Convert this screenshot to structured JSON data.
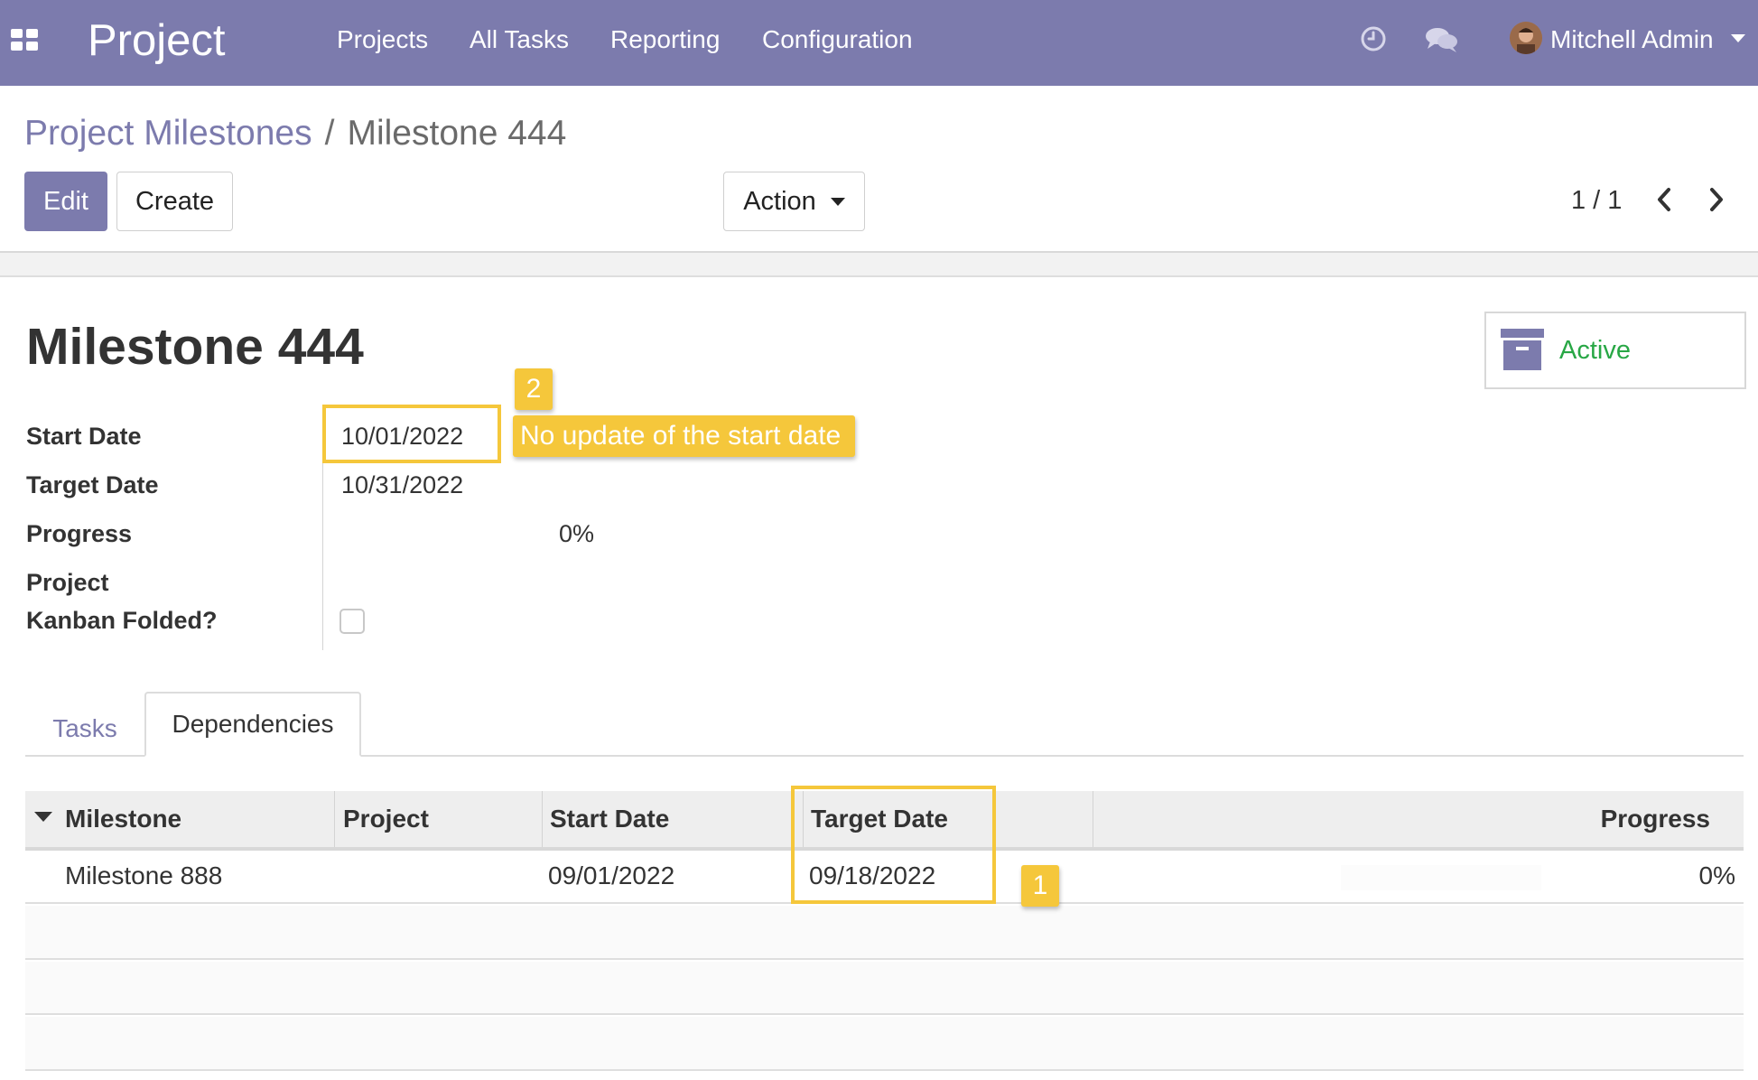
{
  "navbar": {
    "brand": "Project",
    "menu": [
      "Projects",
      "All Tasks",
      "Reporting",
      "Configuration"
    ],
    "user_name": "Mitchell Admin"
  },
  "breadcrumb": {
    "parent": "Project Milestones",
    "separator": "/",
    "current": "Milestone 444"
  },
  "toolbar": {
    "edit_label": "Edit",
    "create_label": "Create",
    "action_label": "Action",
    "pager": "1 / 1"
  },
  "record": {
    "title": "Milestone 444",
    "status_label": "Active",
    "fields": {
      "start_date_label": "Start Date",
      "start_date": "10/01/2022",
      "target_date_label": "Target Date",
      "target_date": "10/31/2022",
      "progress_label": "Progress",
      "progress": "0%",
      "kanban_label_line1": "Project",
      "kanban_label_line2": "Kanban Folded?",
      "kanban_folded": false
    }
  },
  "annotations": {
    "badge_1": "1",
    "badge_2": "2",
    "note_2": "No update of the start date",
    "color": "#f5c73b"
  },
  "tabs": {
    "tasks": "Tasks",
    "dependencies": "Dependencies",
    "active": "Dependencies"
  },
  "dependencies_table": {
    "columns": [
      "Milestone",
      "Project",
      "Start Date",
      "Target Date",
      "Progress"
    ],
    "rows": [
      {
        "milestone": "Milestone 888",
        "project": "",
        "start_date": "09/01/2022",
        "target_date": "09/18/2022",
        "progress": "0%"
      }
    ]
  },
  "colors": {
    "primary": "#7c7bad",
    "active_green": "#28a745",
    "annotation_yellow": "#f5c73b"
  },
  "icons": [
    "apps-icon",
    "clock-icon",
    "chat-icon",
    "chevron-left-icon",
    "chevron-right-icon",
    "archive-icon",
    "sort-caret-icon"
  ]
}
